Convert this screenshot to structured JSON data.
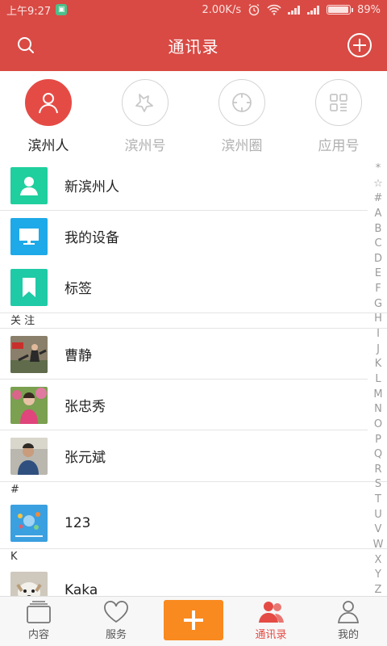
{
  "status": {
    "time": "上午9:27",
    "speed": "2.00K/s",
    "battery": "89%",
    "battery_level": 0.89
  },
  "header": {
    "title": "通讯录"
  },
  "tabs": [
    {
      "label": "滨州人",
      "icon": "person-icon",
      "active": true
    },
    {
      "label": "滨州号",
      "icon": "star-badge-icon",
      "active": false
    },
    {
      "label": "滨州圈",
      "icon": "circle-target-icon",
      "active": false
    },
    {
      "label": "应用号",
      "icon": "app-grid-icon",
      "active": false
    }
  ],
  "fixed_items": [
    {
      "label": "新滨州人",
      "icon": "new-person-icon",
      "color": "#1fcf9d"
    },
    {
      "label": "我的设备",
      "icon": "monitor-icon",
      "color": "#1ea9e8"
    },
    {
      "label": "标签",
      "icon": "bookmark-icon",
      "color": "#1fcaa6"
    }
  ],
  "sections": {
    "follow": "关  注",
    "hash": "#",
    "k": "K"
  },
  "contacts": {
    "cao": "曹静",
    "zhang_zx": "张忠秀",
    "zhang_yb": "张元斌",
    "n123": "123",
    "kaka": "Kaka"
  },
  "index_letters": [
    "*",
    "☆",
    "#",
    "A",
    "B",
    "C",
    "D",
    "E",
    "F",
    "G",
    "H",
    "I",
    "J",
    "K",
    "L",
    "M",
    "N",
    "O",
    "P",
    "Q",
    "R",
    "S",
    "T",
    "U",
    "V",
    "W",
    "X",
    "Y",
    "Z"
  ],
  "bottom_nav": {
    "content": "内容",
    "service": "服务",
    "contacts": "通讯录",
    "mine": "我的"
  },
  "colors": {
    "brand_red": "#d94a44",
    "active_red": "#e54b45",
    "add_orange": "#f98a1f"
  }
}
